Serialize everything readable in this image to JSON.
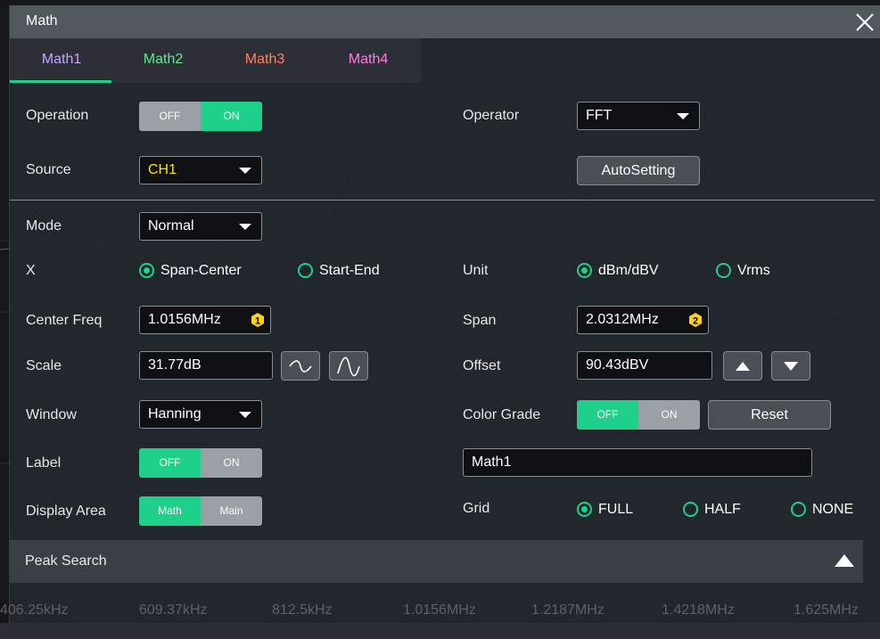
{
  "dialog": {
    "title": "Math"
  },
  "tabs": [
    {
      "label": "Math1",
      "color": "#c6a6ff"
    },
    {
      "label": "Math2",
      "color": "#62e88e"
    },
    {
      "label": "Math3",
      "color": "#ff8066"
    },
    {
      "label": "Math4",
      "color": "#ff7ae6"
    }
  ],
  "operation": {
    "label": "Operation",
    "off": "OFF",
    "on": "ON",
    "state": "ON"
  },
  "operator": {
    "label": "Operator",
    "value": "FFT"
  },
  "source": {
    "label": "Source",
    "value": "CH1",
    "value_color": "#ffe400"
  },
  "autosetting": {
    "label": "AutoSetting"
  },
  "mode": {
    "label": "Mode",
    "value": "Normal"
  },
  "x": {
    "label": "X",
    "options": [
      "Span-Center",
      "Start-End"
    ],
    "selected": "Span-Center"
  },
  "unit": {
    "label": "Unit",
    "options": [
      "dBm/dBV",
      "Vrms"
    ],
    "selected": "dBm/dBV"
  },
  "center_freq": {
    "label": "Center Freq",
    "value": "1.0156MHz",
    "badge": "1"
  },
  "span": {
    "label": "Span",
    "value": "2.0312MHz",
    "badge": "2"
  },
  "scale": {
    "label": "Scale",
    "value": "31.77dB"
  },
  "offset": {
    "label": "Offset",
    "value": "90.43dBV"
  },
  "window": {
    "label": "Window",
    "value": "Hanning"
  },
  "color_grade": {
    "label": "Color Grade",
    "off": "OFF",
    "on": "ON",
    "state": "OFF",
    "reset": "Reset"
  },
  "label_row": {
    "label": "Label",
    "off": "OFF",
    "on": "ON",
    "state": "OFF",
    "text_value": "Math1"
  },
  "display_area": {
    "label": "Display Area",
    "math": "Math",
    "main": "Main",
    "state": "Math"
  },
  "grid": {
    "label": "Grid",
    "options": [
      "FULL",
      "HALF",
      "NONE"
    ],
    "selected": "FULL"
  },
  "peak_search": {
    "label": "Peak Search"
  },
  "freq_axis": [
    "406.25kHz",
    "609.37kHz",
    "812.5kHz",
    "1.0156MHz",
    "1.2187MHz",
    "1.4218MHz",
    "1.625MHz"
  ],
  "colors": {
    "accent": "#1fd08a",
    "badge": "#ffd21e",
    "toggle_off_bg": "#9aa0a6"
  }
}
